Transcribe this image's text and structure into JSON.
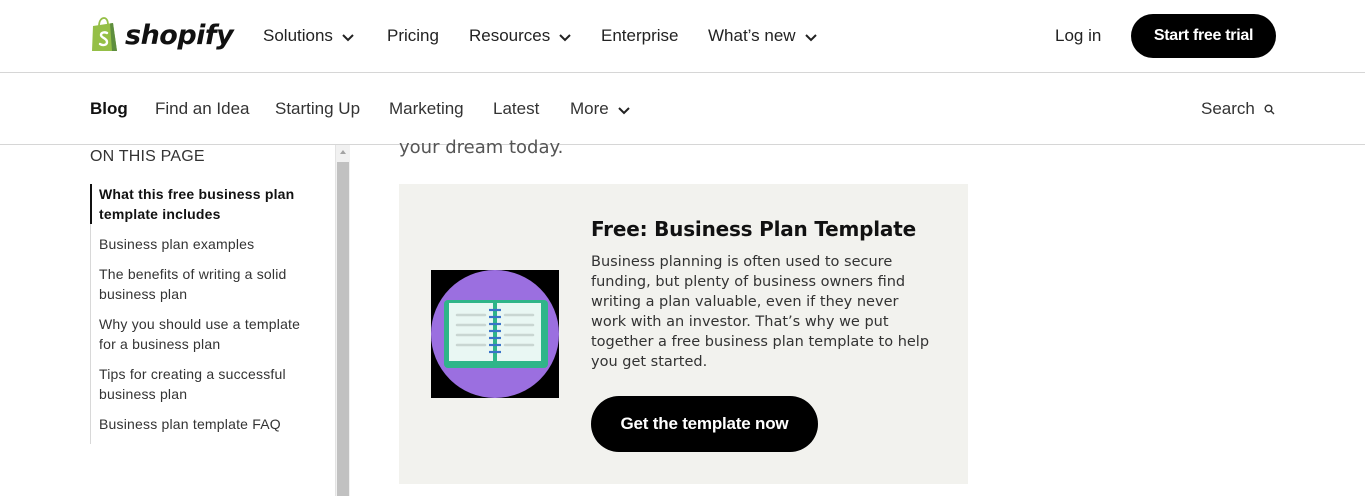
{
  "header": {
    "logo_text": "shopify",
    "nav": [
      {
        "label": "Solutions",
        "dropdown": true
      },
      {
        "label": "Pricing",
        "dropdown": false
      },
      {
        "label": "Resources",
        "dropdown": true
      },
      {
        "label": "Enterprise",
        "dropdown": false
      },
      {
        "label": "What’s new",
        "dropdown": true
      }
    ],
    "login": "Log in",
    "cta": "Start free trial"
  },
  "subnav": {
    "items": [
      {
        "label": "Blog",
        "active": true
      },
      {
        "label": "Find an Idea"
      },
      {
        "label": "Starting Up"
      },
      {
        "label": "Marketing"
      },
      {
        "label": "Latest"
      },
      {
        "label": "More",
        "dropdown": true
      }
    ],
    "search_label": "Search"
  },
  "toc": {
    "title": "ON THIS PAGE",
    "items": [
      "What this free business plan template includes",
      "Business plan examples",
      "The benefits of writing a solid business plan",
      "Why you should use a template for a business plan",
      "Tips for creating a successful business plan",
      "Business plan template FAQ"
    ],
    "active_index": 0
  },
  "article": {
    "partial_text": "your dream today.",
    "card": {
      "title": "Free: Business Plan Template",
      "body": "Business planning is often used to secure funding, but plenty of business owners find writing a plan valuable, even if they never work with an investor. That’s why we put together a free business plan template to help you get started.",
      "button": "Get the template now",
      "image_icon": "open-notebook-icon"
    }
  },
  "colors": {
    "accent_progress": "#6ee26a",
    "logo_green": "#95bf47",
    "card_bg": "#f2f2ee",
    "thumb_circle": "#9b6fe0",
    "notebook_green": "#2fb589"
  },
  "reading_progress": 0.17
}
